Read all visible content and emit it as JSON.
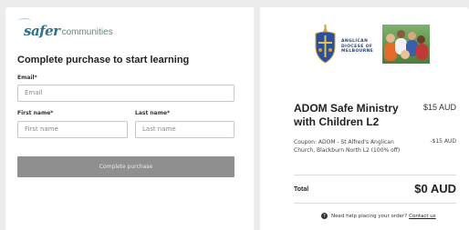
{
  "brand": {
    "logo_script": "safer",
    "logo_plain": "communities"
  },
  "form": {
    "title": "Complete purchase to start learning",
    "email": {
      "label": "Email*",
      "placeholder": "Email"
    },
    "first_name": {
      "label": "First name*",
      "placeholder": "First name"
    },
    "last_name": {
      "label": "Last name*",
      "placeholder": "Last name"
    },
    "submit_label": "Complete purchase"
  },
  "summary": {
    "diocese_lines": [
      "ANGLICAN",
      "DIOCESE OF",
      "MELBOURNE"
    ],
    "product_title": "ADOM Safe Ministry with Children L2",
    "product_price": "$15 AUD",
    "coupon_text": "Coupon: ADOM - St Alfred's Anglican Church, Blackburn North L2 (100% off)",
    "coupon_amount": "-$15 AUD",
    "total_label": "Total",
    "total_value": "$0 AUD",
    "help_text": "Need help placing your order?",
    "help_link": "Contact us"
  },
  "colors": {
    "button_bg": "#8f8f8f",
    "diocese_blue": "#2a3f78",
    "brand_teal": "#2f6f8f"
  },
  "icons": [
    "help-icon",
    "diocese-crest-icon"
  ]
}
